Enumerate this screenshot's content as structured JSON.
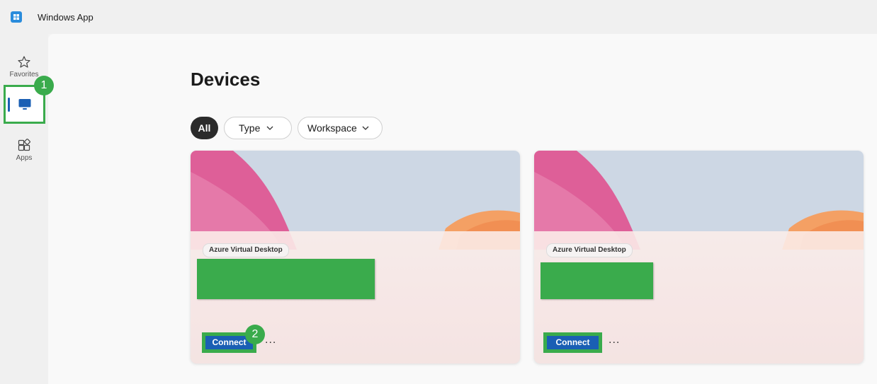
{
  "app": {
    "title": "Windows App"
  },
  "sidebar": {
    "items": [
      {
        "id": "favorites",
        "label": "Favorites",
        "icon": "star-icon"
      },
      {
        "id": "devices",
        "label": "",
        "icon": "monitor-icon",
        "active": true
      },
      {
        "id": "apps",
        "label": "Apps",
        "icon": "apps-grid-icon"
      }
    ]
  },
  "annotations": {
    "step1": "1",
    "step2": "2"
  },
  "main": {
    "title": "Devices",
    "filters": {
      "all": "All",
      "type": "Type",
      "workspace": "Workspace"
    },
    "cards": [
      {
        "tag": "Azure Virtual Desktop",
        "connect_label": "Connect",
        "more_label": "..."
      },
      {
        "tag": "Azure Virtual Desktop",
        "connect_label": "Connect",
        "more_label": "..."
      }
    ]
  },
  "colors": {
    "highlight": "#3aab4c",
    "accent": "#1a5fb4",
    "filter_active_bg": "#2b2b2b"
  }
}
